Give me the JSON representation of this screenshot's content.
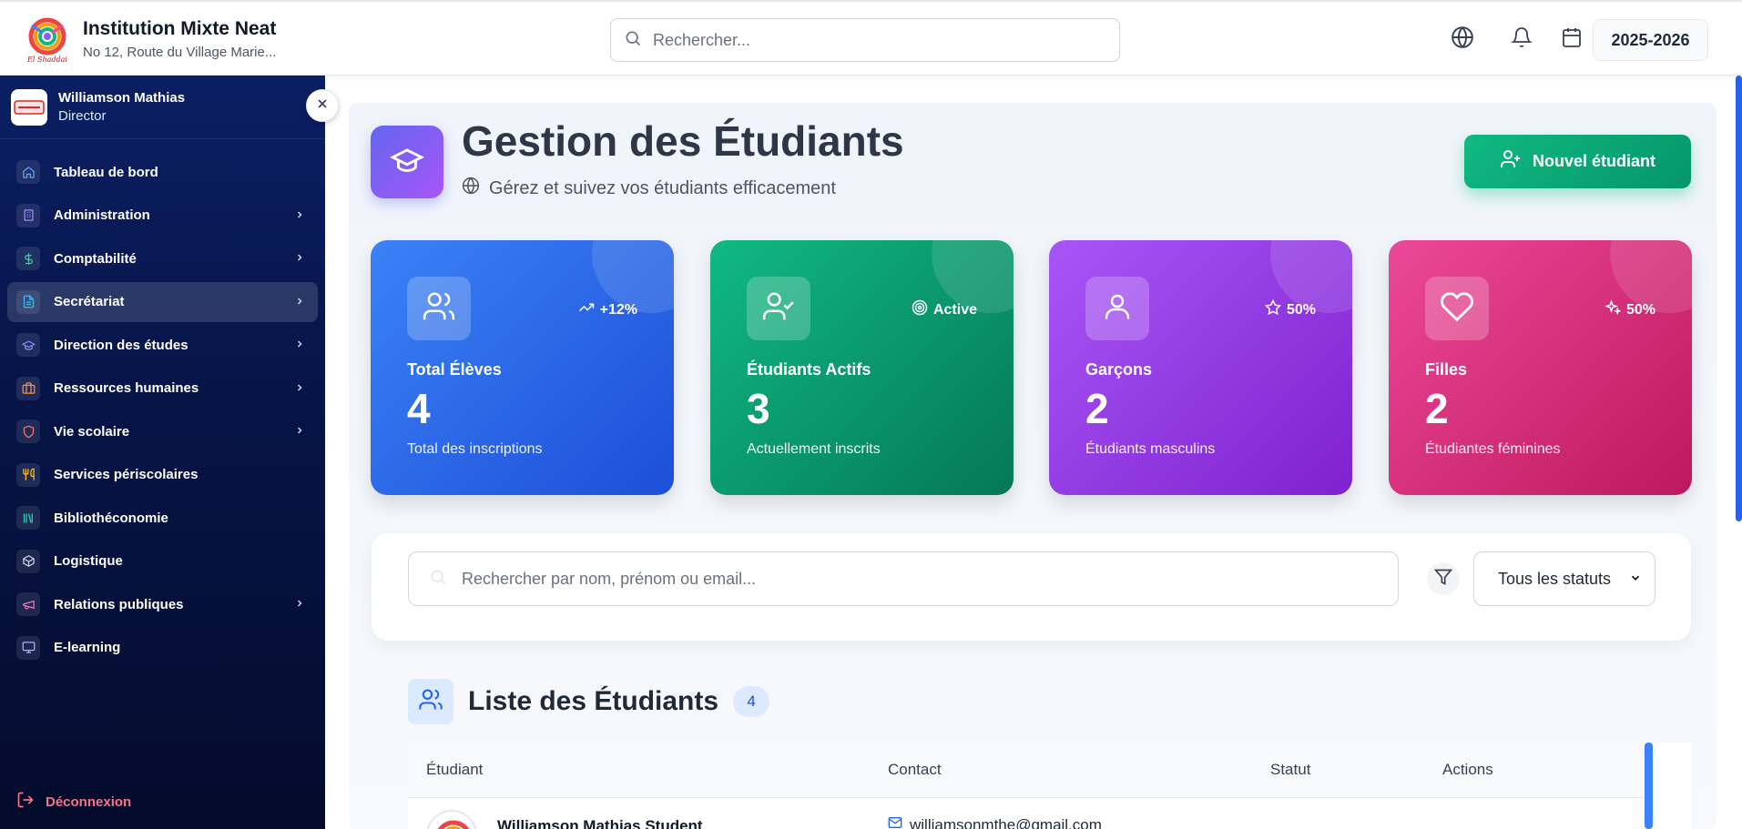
{
  "header": {
    "institution": "Institution Mixte Neat",
    "address": "No 12, Route du Village Marie...",
    "search_placeholder": "Rechercher...",
    "school_year": "2025-2026"
  },
  "sidebar": {
    "user_name": "Williamson Mathias",
    "user_role": "Director",
    "items": [
      {
        "label": "Tableau de bord",
        "icon": "home-icon",
        "color": "#60a5fa",
        "chevron": false
      },
      {
        "label": "Administration",
        "icon": "building-icon",
        "color": "#a78bfa",
        "chevron": true
      },
      {
        "label": "Comptabilité",
        "icon": "dollar-icon",
        "color": "#34d399",
        "chevron": true
      },
      {
        "label": "Secrétariat",
        "icon": "file-text-icon",
        "color": "#38bdf8",
        "chevron": true
      },
      {
        "label": "Direction des études",
        "icon": "graduation-cap-icon",
        "color": "#818cf8",
        "chevron": true
      },
      {
        "label": "Ressources humaines",
        "icon": "briefcase-icon",
        "color": "#fb923c",
        "chevron": true
      },
      {
        "label": "Vie scolaire",
        "icon": "shield-icon",
        "color": "#f87171",
        "chevron": true
      },
      {
        "label": "Services périscolaires",
        "icon": "utensils-icon",
        "color": "#fbbf24",
        "chevron": false
      },
      {
        "label": "Bibliothéconomie",
        "icon": "library-icon",
        "color": "#2dd4bf",
        "chevron": false
      },
      {
        "label": "Logistique",
        "icon": "package-icon",
        "color": "#cbd5e1",
        "chevron": false
      },
      {
        "label": "Relations publiques",
        "icon": "megaphone-icon",
        "color": "#f472b6",
        "chevron": true
      },
      {
        "label": "E-learning",
        "icon": "monitor-icon",
        "color": "#a5b4fc",
        "chevron": false
      }
    ],
    "active_index": 3,
    "logout": "Déconnexion"
  },
  "page": {
    "title": "Gestion des Étudiants",
    "subtitle": "Gérez et suivez vos étudiants efficacement",
    "new_button": "Nouvel étudiant"
  },
  "stats": [
    {
      "label": "Total Élèves",
      "value": "4",
      "desc": "Total des inscriptions",
      "trend": "+12%",
      "icon": "users-icon",
      "trend_icon": "trending-up-icon"
    },
    {
      "label": "Étudiants Actifs",
      "value": "3",
      "desc": "Actuellement inscrits",
      "trend": "Active",
      "icon": "user-check-icon",
      "trend_icon": "target-icon"
    },
    {
      "label": "Garçons",
      "value": "2",
      "desc": "Étudiants masculins",
      "trend": "50%",
      "icon": "user-icon",
      "trend_icon": "star-icon"
    },
    {
      "label": "Filles",
      "value": "2",
      "desc": "Étudiantes féminines",
      "trend": "50%",
      "icon": "heart-icon",
      "trend_icon": "sparkles-icon"
    }
  ],
  "filters": {
    "search_placeholder": "Rechercher par nom, prénom ou email...",
    "status_value": "Tous les statuts"
  },
  "list": {
    "title": "Liste des Étudiants",
    "count": "4",
    "columns": [
      "Étudiant",
      "Contact",
      "Statut",
      "Actions"
    ],
    "rows": [
      {
        "name": "Williamson Mathias Student",
        "email": "williamsonmthe@gmail.com"
      }
    ]
  }
}
